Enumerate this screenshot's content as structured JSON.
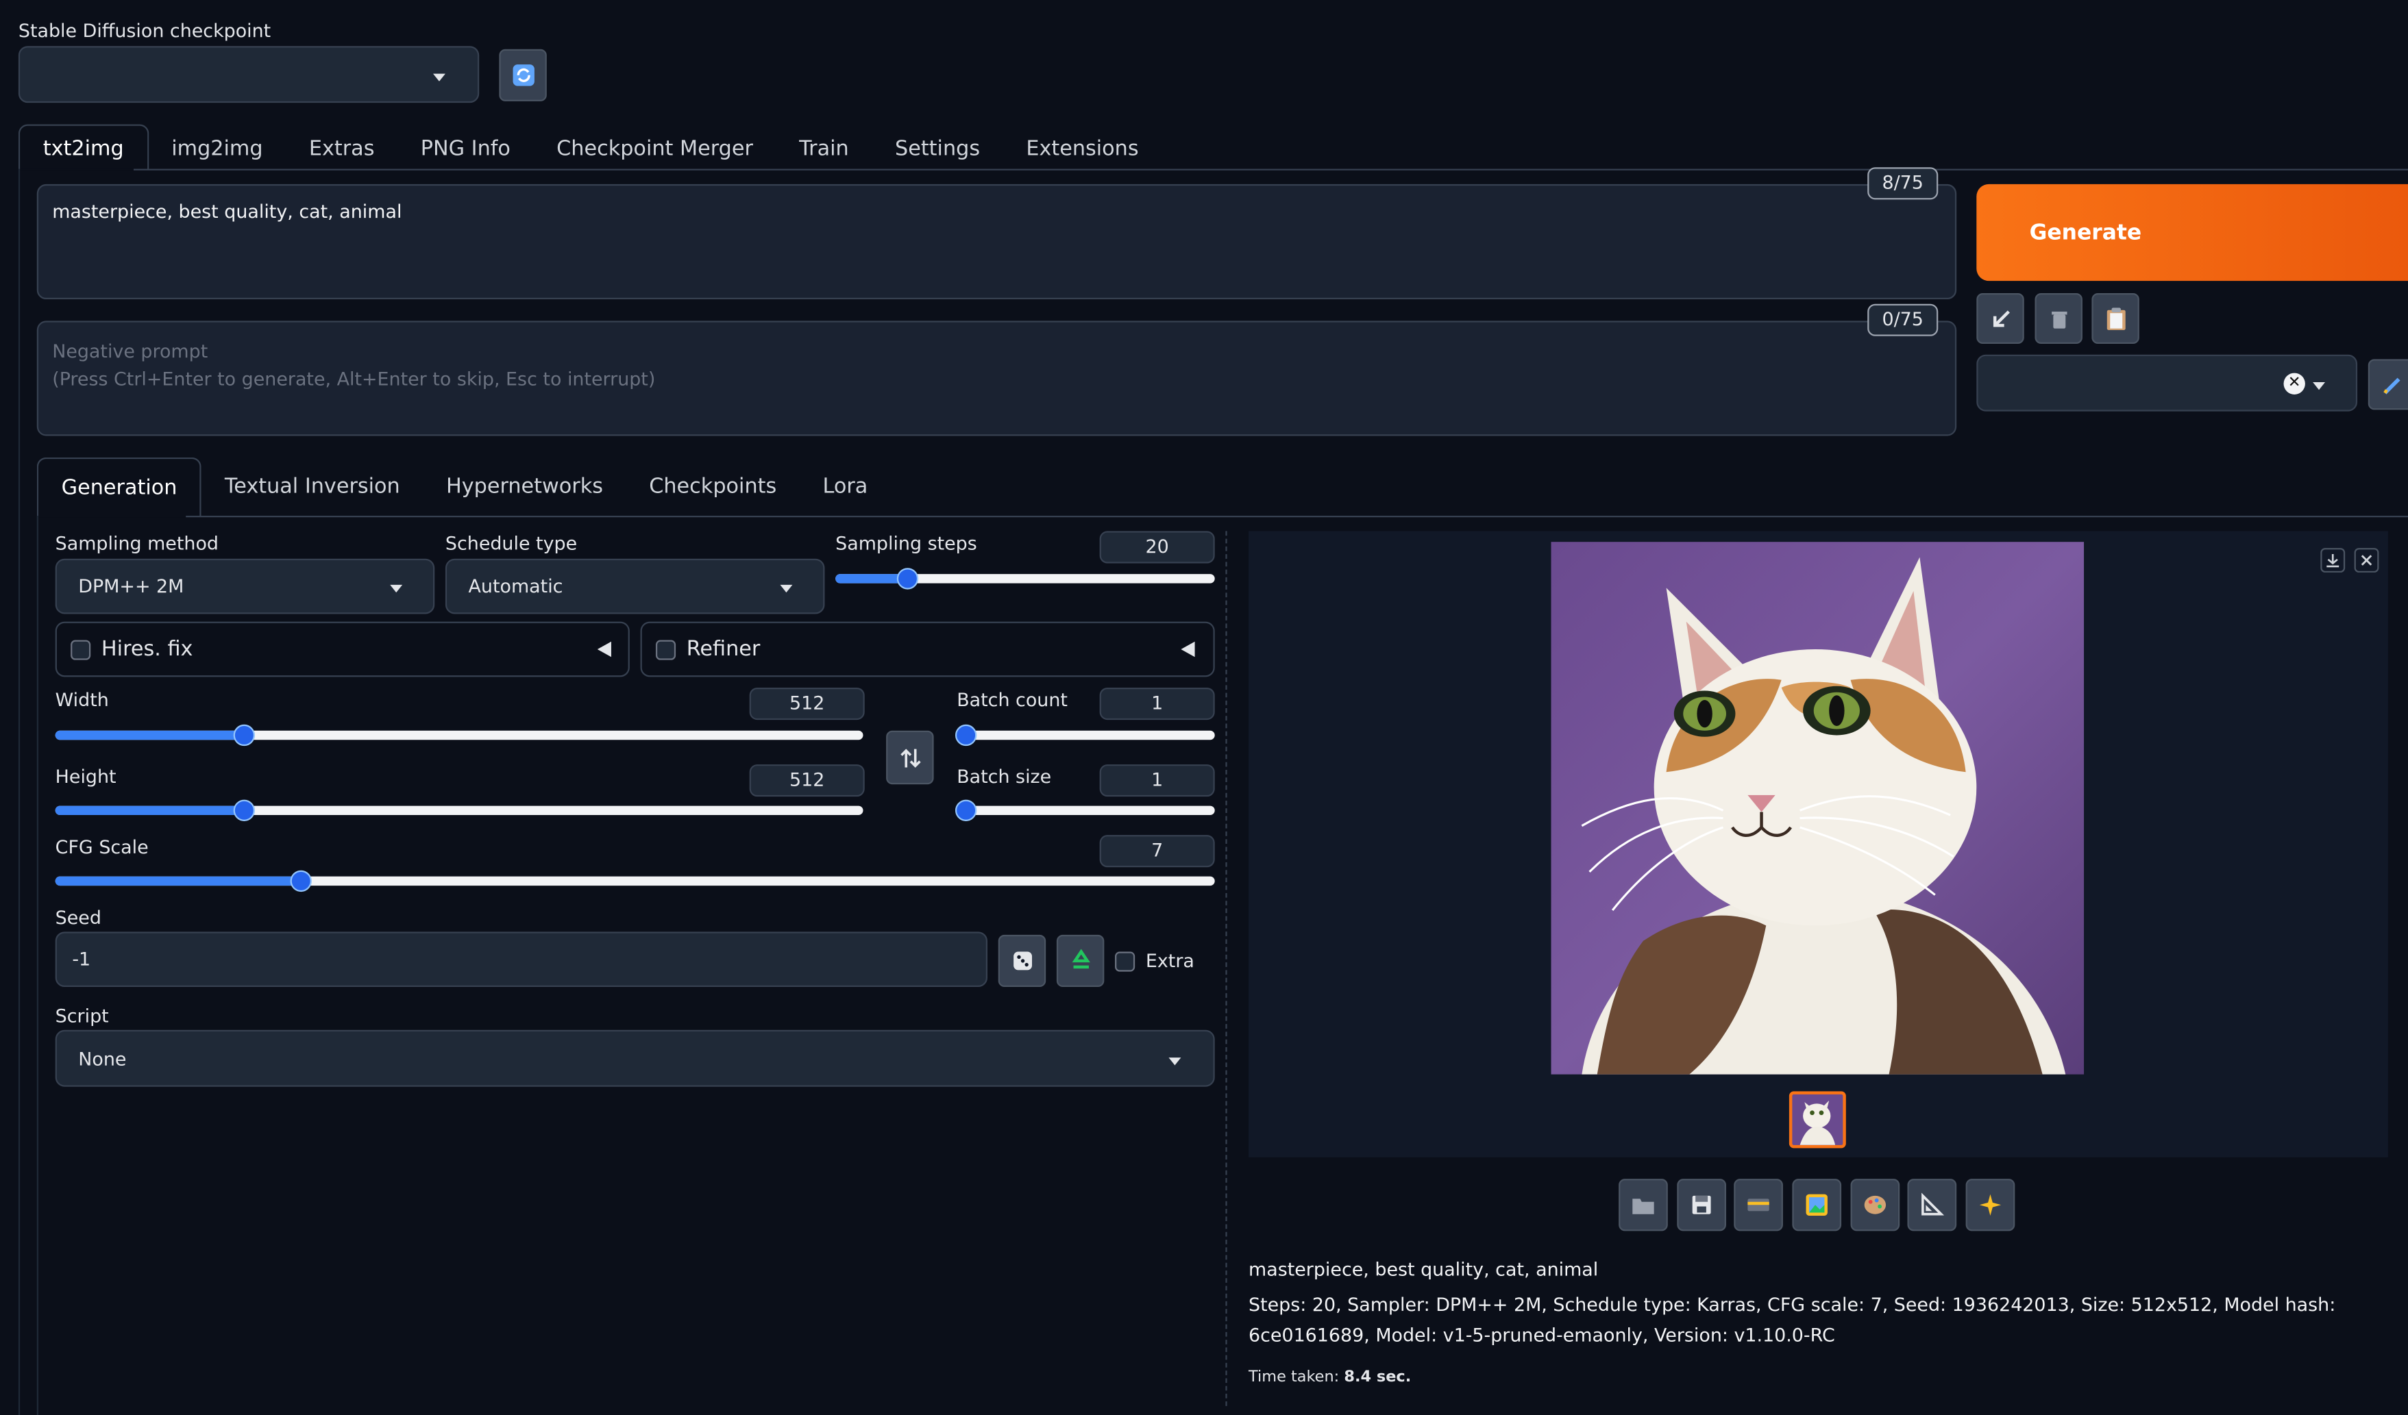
{
  "checkpoint": {
    "label": "Stable Diffusion checkpoint",
    "value": ""
  },
  "main_tabs": [
    "txt2img",
    "img2img",
    "Extras",
    "PNG Info",
    "Checkpoint Merger",
    "Train",
    "Settings",
    "Extensions"
  ],
  "prompt": {
    "value": "masterpiece, best quality, cat, animal",
    "token_count": "8/75"
  },
  "negative_prompt": {
    "placeholder": "Negative prompt\n(Press Ctrl+Enter to generate, Alt+Enter to skip, Esc to interrupt)",
    "token_count": "0/75"
  },
  "generate_label": "Generate",
  "sub_tabs": [
    "Generation",
    "Textual Inversion",
    "Hypernetworks",
    "Checkpoints",
    "Lora"
  ],
  "sampling_method": {
    "label": "Sampling method",
    "value": "DPM++ 2M"
  },
  "schedule_type": {
    "label": "Schedule type",
    "value": "Automatic"
  },
  "sampling_steps": {
    "label": "Sampling steps",
    "value": "20",
    "fraction": 0.19
  },
  "hires_fix": {
    "label": "Hires. fix"
  },
  "refiner": {
    "label": "Refiner"
  },
  "width": {
    "label": "Width",
    "value": "512",
    "fraction": 0.233
  },
  "height": {
    "label": "Height",
    "value": "512",
    "fraction": 0.233
  },
  "batch_count": {
    "label": "Batch count",
    "value": "1",
    "fraction": 0.0
  },
  "batch_size": {
    "label": "Batch size",
    "value": "1",
    "fraction": 0.0
  },
  "cfg_scale": {
    "label": "CFG Scale",
    "value": "7",
    "fraction": 0.212
  },
  "seed": {
    "label": "Seed",
    "value": "-1",
    "extra_label": "Extra"
  },
  "script": {
    "label": "Script",
    "value": "None"
  },
  "output": {
    "prompt_line": "masterpiece, best quality, cat, animal",
    "params_line": "Steps: 20, Sampler: DPM++ 2M, Schedule type: Karras, CFG scale: 7, Seed: 1936242013, Size: 512x512, Model hash: 6ce0161689, Model: v1-5-pruned-emaonly, Version: v1.10.0-RC",
    "time_label": "Time taken:",
    "time_value": "8.4 sec."
  },
  "colors": {
    "accent": "#ea580c",
    "slider": "#3b82f6",
    "background": "#0b0f19"
  }
}
